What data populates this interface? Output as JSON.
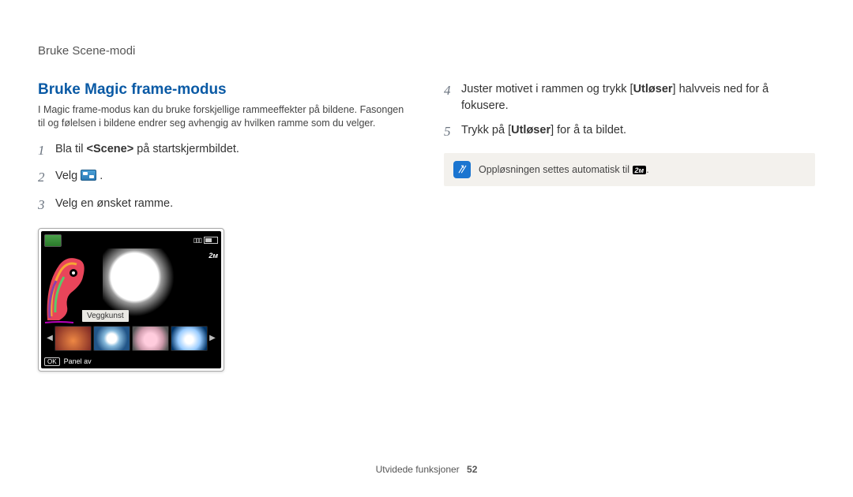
{
  "header": {
    "breadcrumb": "Bruke Scene-modi"
  },
  "section": {
    "title": "Bruke Magic frame-modus",
    "intro": "I Magic frame-modus kan du bruke forskjellige rammeeffekter på bildene. Fasongen til og følelsen i bildene endrer seg avhengig av hvilken ramme som du velger."
  },
  "steps": {
    "n1": "1",
    "s1_pre": "Bla til ",
    "s1_bold": "<Scene>",
    "s1_post": " på startskjermbildet.",
    "n2": "2",
    "s2_pre": "Velg ",
    "s2_post": " .",
    "n3": "3",
    "s3": "Velg en ønsket ramme.",
    "n4": "4",
    "s4_pre": "Juster motivet i rammen og trykk [",
    "s4_bold": "Utløser",
    "s4_post": "] halvveis ned for å fokusere.",
    "n5": "5",
    "s5_pre": "Trykk på [",
    "s5_bold": "Utløser",
    "s5_post": "] for å ta bildet."
  },
  "screenshot": {
    "frame_label": "Veggkunst",
    "ok_label": "OK",
    "panel_label": "Panel av",
    "res_badge": "2ᴍ"
  },
  "note": {
    "text_pre": "Oppløsningen settes automatisk til ",
    "res": "2ᴍ",
    "text_post": "."
  },
  "footer": {
    "label": "Utvidede funksjoner",
    "page": "52"
  }
}
